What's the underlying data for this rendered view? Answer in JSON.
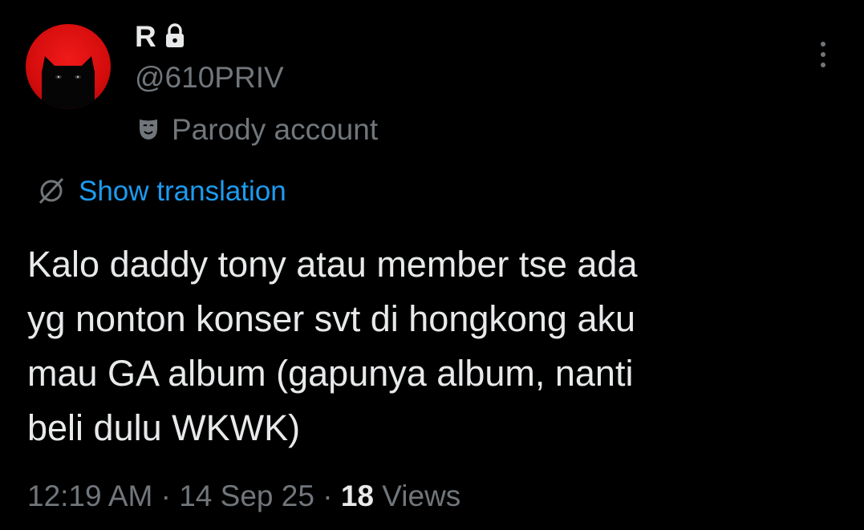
{
  "tweet": {
    "author": {
      "display_name": "R",
      "handle": "@610PRIV",
      "label": "Parody account",
      "avatar": {
        "description_icon": "black-cat-peeking-avatar",
        "background_color": "#e01010"
      },
      "protected_icon": "lock-icon",
      "label_icon": "theater-masks-icon"
    },
    "more_icon": "more-vertical-icon",
    "translation": {
      "label": "Show translation",
      "icon": "globe-icon",
      "color": "#1d9bf0"
    },
    "text": "Kalo daddy tony atau member tse ada\nyg nonton konser svt di hongkong aku\nmau GA album (gapunya album, nanti\nbeli dulu WKWK)",
    "meta": {
      "time": "12:19 AM",
      "separator": "·",
      "date": "14 Sep 25",
      "views_count": "18",
      "views_label": "Views"
    }
  },
  "colors": {
    "background": "#000000",
    "primary_text": "#e7e9ea",
    "secondary_text": "#71767b",
    "link": "#1d9bf0"
  }
}
